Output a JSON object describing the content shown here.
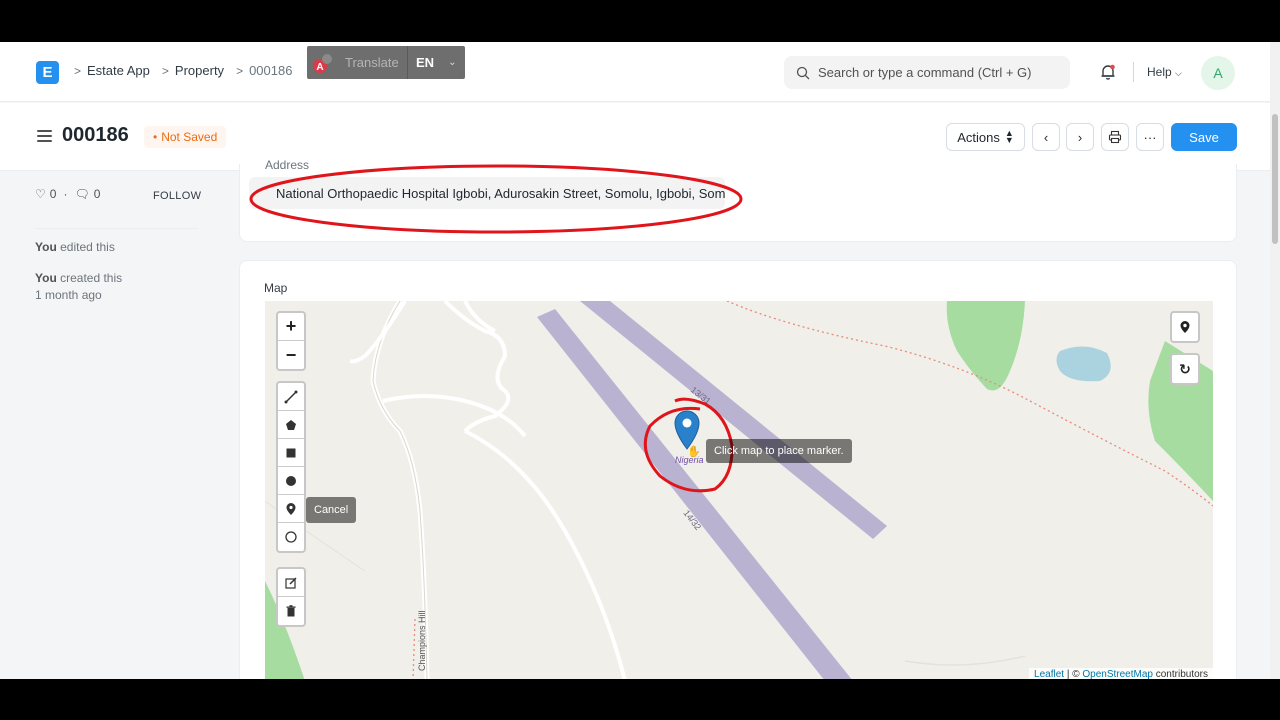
{
  "navbar": {
    "logo_letter": "E",
    "breadcrumbs": [
      "Estate App",
      "Property",
      "000186"
    ],
    "translate": {
      "label": "Translate",
      "language": "EN"
    },
    "search_placeholder": "Search or type a command (Ctrl + G)",
    "help_label": "Help",
    "avatar_letter": "A"
  },
  "page_head": {
    "title": "000186",
    "status_badge": "Not Saved",
    "actions_label": "Actions",
    "more_label": "···",
    "save_label": "Save"
  },
  "sidebar": {
    "likes_count": "0",
    "comments_count": "0",
    "follow_label": "FOLLOW",
    "activity": [
      {
        "who": "You",
        "what": " edited this",
        "when": ""
      },
      {
        "who": "You",
        "what": " created this",
        "when": "1 month ago"
      }
    ]
  },
  "address_card": {
    "label": "Address",
    "value": "National Orthopaedic Hospital Igbobi, Adurosakin Street, Somolu, Igbobi, Somolu"
  },
  "map_card": {
    "label": "Map",
    "tooltip": "Click map to place marker.",
    "cancel_label": "Cancel",
    "runway_labels": [
      "13/31",
      "14/32"
    ],
    "marker_label": "Nigeria",
    "street_label": "Champions Hill",
    "attribution": {
      "leaflet": "Leaflet",
      "separator": " | © ",
      "osm": "OpenStreetMap",
      "suffix": " contributors"
    }
  },
  "colors": {
    "accent": "#2490ef",
    "annotation_red": "#e0141b",
    "runway": "#b9b3d1",
    "park": "#a7dca0",
    "water": "#aad3df"
  }
}
